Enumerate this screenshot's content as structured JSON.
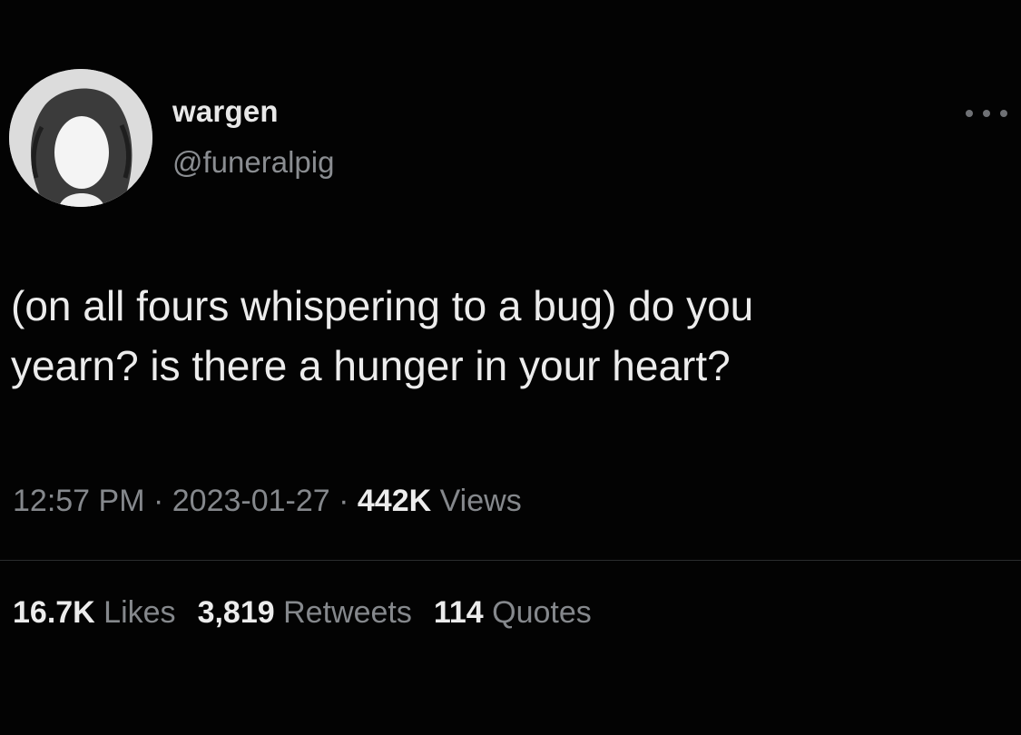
{
  "user": {
    "display_name": "wargen",
    "handle": "@funeralpig",
    "avatar_icon": "profile-avatar"
  },
  "more_icon": "more-dots-icon",
  "tweet": {
    "text_line1": "(on all fours whispering to a bug) do you",
    "text_line2": "yearn? is there a hunger in your heart?"
  },
  "meta": {
    "time": "12:57 PM",
    "sep1": " · ",
    "date": "2023-01-27",
    "sep2": " · ",
    "views_count": "442K",
    "views_label": " Views"
  },
  "stats": {
    "likes_count": "16.7K",
    "likes_label": " Likes",
    "retweets_count": "3,819",
    "retweets_label": " Retweets",
    "quotes_count": "114",
    "quotes_label": " Quotes"
  },
  "colors": {
    "background": "#030303",
    "primary_text": "#ececec",
    "secondary_text": "#85888c"
  }
}
